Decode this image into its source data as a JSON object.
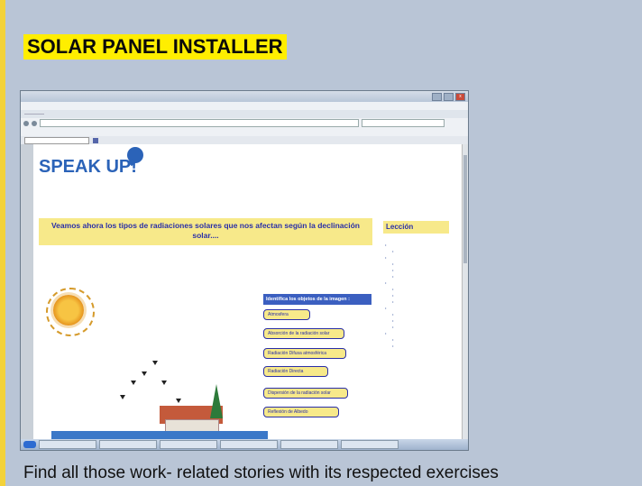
{
  "page": {
    "title": "SOLAR PANEL INSTALLER",
    "caption": "Find all those work- related stories with its respected exercises"
  },
  "colors": {
    "background": "#b9c5d6",
    "title_highlight": "#ffee00",
    "left_border": "#f3d23a",
    "brand_blue": "#2b63b8",
    "lesson_yellow": "#f7e98a",
    "link_blue": "#2a2fa8"
  },
  "screenshot": {
    "logo_text": "SPEAK UP!",
    "lesson_title": "Veamos ahora los tipos de radiaciones solares que nos afectan según la declinación solar....",
    "sidebar_header": "Lección",
    "identify_title": "Identifica los objetos de la imagen :",
    "options": [
      "Atmosfera",
      "Absorción de la radiación solar",
      "Radiación Difusa atmosférica",
      "Radiación Directa",
      "Dispersión de la radiación solar",
      "Reflexión de Albedo"
    ]
  }
}
